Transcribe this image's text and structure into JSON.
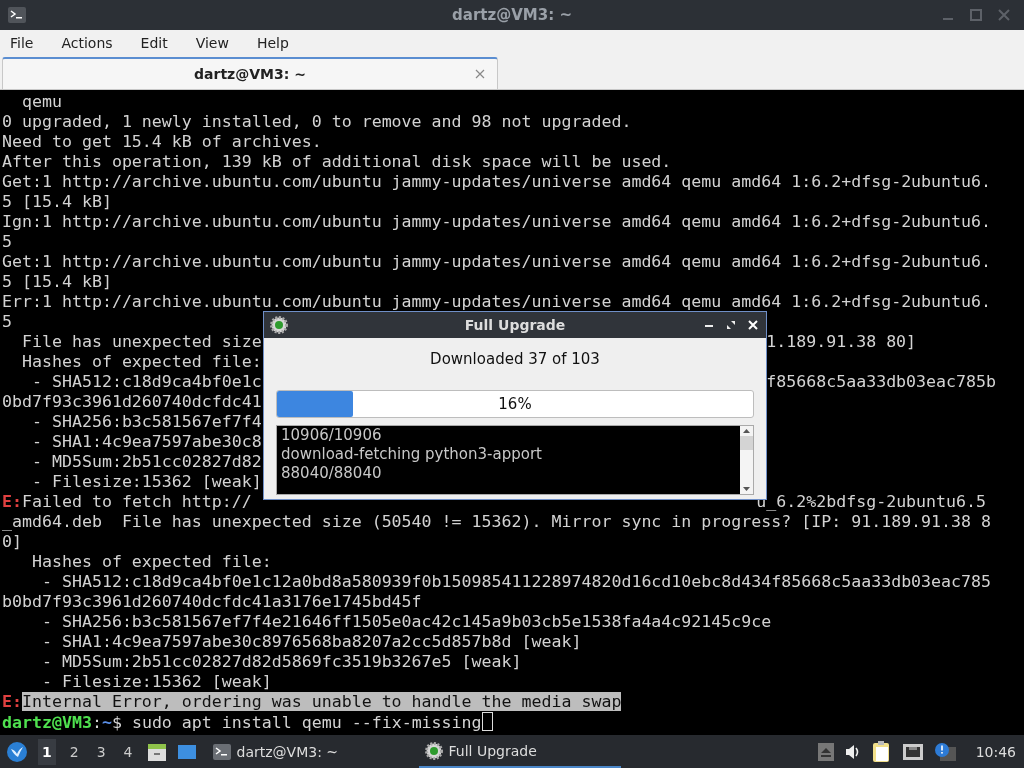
{
  "window": {
    "title": "dartz@VM3: ~"
  },
  "menu": [
    "File",
    "Actions",
    "Edit",
    "View",
    "Help"
  ],
  "tabs": [
    {
      "label": "dartz@VM3: ~",
      "selected": true
    }
  ],
  "terminal": {
    "lines": [
      {
        "kind": "output",
        "text": "  qemu"
      },
      {
        "kind": "output",
        "text": "0 upgraded, 1 newly installed, 0 to remove and 98 not upgraded."
      },
      {
        "kind": "output",
        "text": "Need to get 15.4 kB of archives."
      },
      {
        "kind": "output",
        "text": "After this operation, 139 kB of additional disk space will be used."
      },
      {
        "kind": "output",
        "text": "Get:1 http://archive.ubuntu.com/ubuntu jammy-updates/universe amd64 qemu amd64 1:6.2+dfsg-2ubuntu6."
      },
      {
        "kind": "output",
        "text": "5 [15.4 kB]"
      },
      {
        "kind": "output",
        "text": "Ign:1 http://archive.ubuntu.com/ubuntu jammy-updates/universe amd64 qemu amd64 1:6.2+dfsg-2ubuntu6."
      },
      {
        "kind": "output",
        "text": "5"
      },
      {
        "kind": "output",
        "text": "Get:1 http://archive.ubuntu.com/ubuntu jammy-updates/universe amd64 qemu amd64 1:6.2+dfsg-2ubuntu6."
      },
      {
        "kind": "output",
        "text": "5 [15.4 kB]"
      },
      {
        "kind": "output",
        "text": "Err:1 http://archive.ubuntu.com/ubuntu jammy-updates/universe amd64 qemu amd64 1:6.2+dfsg-2ubuntu6."
      },
      {
        "kind": "output",
        "text": "5"
      },
      {
        "kind": "output",
        "left": "  File has unexpected size",
        "right": "1.189.91.38 80]"
      },
      {
        "kind": "output",
        "text": "  Hashes of expected file:"
      },
      {
        "kind": "output",
        "left": "   - SHA512:c18d9ca4bf0e1c",
        "right": "f85668c5aa33db03eac785b"
      },
      {
        "kind": "output",
        "text": "0bd7f93c3961d260740dcfdc41"
      },
      {
        "kind": "output",
        "text": "   - SHA256:b3c581567ef7f4"
      },
      {
        "kind": "output",
        "text": "   - SHA1:4c9ea7597abe30c8"
      },
      {
        "kind": "output",
        "text": "   - MD5Sum:2b51cc02827d82"
      },
      {
        "kind": "output",
        "text": "   - Filesize:15362 [weak]"
      },
      {
        "kind": "error",
        "prefix": "E:",
        "highlighted": false,
        "left": "Failed to fetch http://",
        "right": "u_6.2%2bdfsg-2ubuntu6.5"
      },
      {
        "kind": "output",
        "text": "_amd64.deb  File has unexpected size (50540 != 15362). Mirror sync in progress? [IP: 91.189.91.38 8"
      },
      {
        "kind": "output",
        "text": "0]"
      },
      {
        "kind": "output",
        "text": "   Hashes of expected file:"
      },
      {
        "kind": "output",
        "text": "    - SHA512:c18d9ca4bf0e1c12a0bd8a580939f0b150985411228974820d16cd10ebc8d434f85668c5aa33db03eac785"
      },
      {
        "kind": "output",
        "text": "b0bd7f93c3961d260740dcfdc41a3176e1745bd45f"
      },
      {
        "kind": "output",
        "text": "    - SHA256:b3c581567ef7f4e21646ff1505e0ac42c145a9b03cb5e1538fa4a4c92145c9ce"
      },
      {
        "kind": "output",
        "text": "    - SHA1:4c9ea7597abe30c8976568ba8207a2cc5d857b8d [weak]"
      },
      {
        "kind": "output",
        "text": "    - MD5Sum:2b51cc02827d82d5869fc3519b3267e5 [weak]"
      },
      {
        "kind": "output",
        "text": "    - Filesize:15362 [weak]"
      },
      {
        "kind": "error",
        "prefix": "E:",
        "highlighted": true,
        "text": "Internal Error, ordering was unable to handle the media swap"
      }
    ],
    "prompt": {
      "user": "dartz@VM3",
      "separator": ":",
      "path": "~",
      "symbol": "$",
      "command": "sudo apt install qemu --fix-missing"
    }
  },
  "dialog": {
    "title": "Full Upgrade",
    "status": "Downloaded 37 of 103",
    "progress": {
      "level": 0.16,
      "label": "16%"
    },
    "log": [
      "10906/10906",
      "download-fetching python3-apport",
      "88040/88040"
    ]
  },
  "taskbar": {
    "workspaces": [
      {
        "label": "1",
        "selected": true
      },
      {
        "label": "2",
        "selected": false
      },
      {
        "label": "3",
        "selected": false
      },
      {
        "label": "4",
        "selected": false
      }
    ],
    "tasks": [
      {
        "kind": "terminal",
        "label": "dartz@VM3: ~",
        "selected": false
      },
      {
        "kind": "upgrade",
        "label": "Full Upgrade",
        "selected": true
      }
    ],
    "clock": "10:46"
  }
}
